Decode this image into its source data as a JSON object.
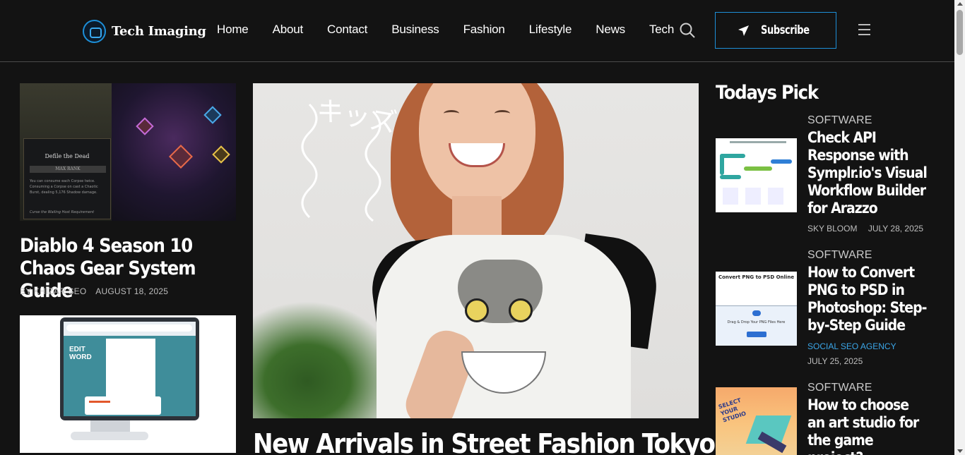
{
  "header": {
    "logo_text": "Tech Imaging",
    "nav": [
      "Home",
      "About",
      "Contact",
      "Business",
      "Fashion",
      "Lifestyle",
      "News",
      "Tech"
    ],
    "subscribe_label": "Subscribe",
    "accent_color": "#1d8fd8"
  },
  "left_column": {
    "article1": {
      "title": "Diablo 4 Season 10 Chaos Gear System Guide",
      "author": "BY KHIZAR SEO",
      "date": "AUGUST 18, 2025",
      "image_text": {
        "card_title": "Defile the Dead",
        "rank": "MAX RANK",
        "desc": "You can consume each Corpse twice. Consuming a Corpse on cast a Chaotic Burst, dealing 5,176 Shadow damage.",
        "footer": "Curse the Wailing Host Requirement"
      }
    },
    "article2": {
      "image_text": {
        "edit": "EDIT",
        "word": "WORD"
      }
    }
  },
  "featured": {
    "title": "New Arrivals in Street Fashion Tokyo",
    "image_text": "キッズ"
  },
  "todays_pick": {
    "heading": "Todays Pick",
    "items": [
      {
        "category": "SOFTWARE",
        "title": "Check API Response with Symplr.io's Visual Workflow Builder for Arazzo",
        "author": "SKY BLOOM",
        "date": "JULY 28, 2025"
      },
      {
        "category": "SOFTWARE",
        "title": "How to Convert PNG to PSD in Photoshop: Step-by-Step Guide",
        "author": "SOCIAL SEO AGENCY",
        "date": "JULY 25, 2025",
        "image_text": {
          "heading": "Convert PNG to PSD Online",
          "drop": "Drag & Drop Your PNG Files Here"
        }
      },
      {
        "category": "SOFTWARE",
        "title": "How to choose an art studio for the game project?",
        "image_text": "SELECT YOUR STUDIO"
      }
    ]
  }
}
